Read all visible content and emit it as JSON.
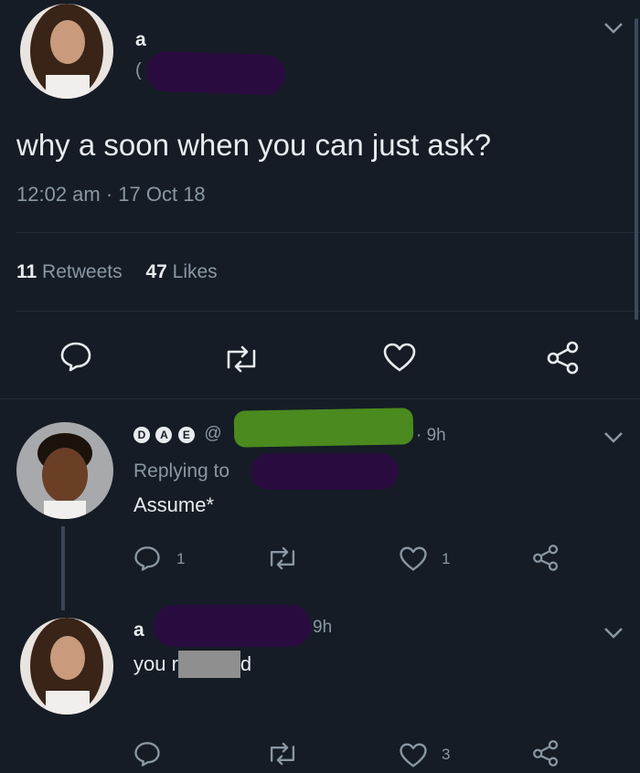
{
  "tweet": {
    "author_name": "a",
    "handle_prefix": "(",
    "text": "why a soon when you can just ask?",
    "timestamp": "12:02 am · 17 Oct 18",
    "retweets_count": "11",
    "retweets_label": "Retweets",
    "likes_count": "47",
    "likes_label": "Likes"
  },
  "reply1": {
    "badges": [
      "D",
      "A",
      "E"
    ],
    "handle_prefix": "@",
    "time": "· 9h",
    "replying_to": "Replying to",
    "text": "Assume*",
    "reply_count": "1",
    "like_count": "1"
  },
  "reply2": {
    "author_name": "a",
    "time": "9h",
    "text_start": "you r",
    "text_end": "d",
    "like_count": "3"
  },
  "colors": {
    "background": "#151c25",
    "text": "#e8ecef",
    "muted": "#8a97a4",
    "scribble_purple": "#2a0b40",
    "scribble_green": "#4a8a1f"
  }
}
